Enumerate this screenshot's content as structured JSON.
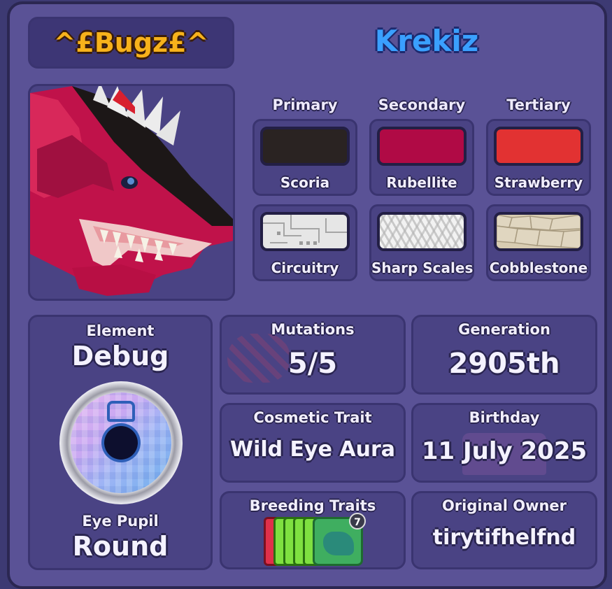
{
  "header": {
    "owner_tag": "^£Bugz£^",
    "creature_name": "Krekiz"
  },
  "colors": {
    "columns": [
      "Primary",
      "Secondary",
      "Tertiary"
    ],
    "swatches": [
      {
        "name": "Scoria",
        "color": "#2a2322"
      },
      {
        "name": "Rubellite",
        "color": "#b00a45"
      },
      {
        "name": "Strawberry",
        "color": "#e23232"
      }
    ],
    "patterns": [
      {
        "name": "Circuitry",
        "pattern": "circuitry"
      },
      {
        "name": "Sharp Scales",
        "pattern": "sharp-scales"
      },
      {
        "name": "Cobblestone",
        "pattern": "cobblestone"
      }
    ]
  },
  "element": {
    "label": "Element",
    "value": "Debug",
    "eye_label": "Eye Pupil",
    "eye_value": "Round"
  },
  "stats": {
    "mutations": {
      "label": "Mutations",
      "value": "5/5"
    },
    "generation": {
      "label": "Generation",
      "value": "2905th"
    },
    "cosmetic": {
      "label": "Cosmetic Trait",
      "value": "Wild Eye Aura"
    },
    "birthday": {
      "label": "Birthday",
      "value": "11 July 2025"
    },
    "breeding": {
      "label": "Breeding Traits",
      "badge": "7"
    },
    "owner": {
      "label": "Original Owner",
      "value": "tirytifhelfnd"
    }
  },
  "palette": {
    "accent_name": "#3aa0ff",
    "owner_tag": "#f7b21b"
  }
}
